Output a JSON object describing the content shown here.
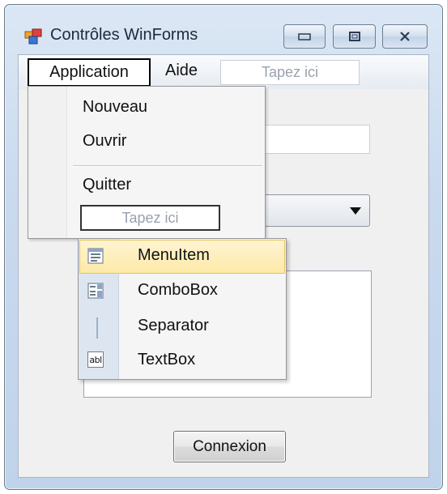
{
  "window": {
    "title": "Contrôles WinForms",
    "icon": "winforms-app-icon",
    "caption_buttons": [
      "minimize-icon",
      "maximize-icon",
      "close-icon"
    ]
  },
  "menubar": {
    "items": [
      {
        "label": "Application",
        "open": true
      },
      {
        "label": "Aide"
      }
    ],
    "type_here": "Tapez ici"
  },
  "dropdown": {
    "items": [
      "Nouveau",
      "Ouvrir",
      "Quitter"
    ],
    "type_here": "Tapez ici"
  },
  "submenu": {
    "items": [
      {
        "label": "MenuItem",
        "icon": "menuitem-icon",
        "highlighted": true
      },
      {
        "label": "ComboBox",
        "icon": "combobox-icon"
      },
      {
        "label": "Separator",
        "icon": "separator-icon"
      },
      {
        "label": "TextBox",
        "icon": "textbox-icon",
        "icon_text": "abl"
      }
    ]
  },
  "form": {
    "connect_button": "Connexion"
  },
  "colors": {
    "highlight_fill": "#fde9a8",
    "highlight_border": "#e5c365",
    "titlebar": "#c9daee"
  }
}
